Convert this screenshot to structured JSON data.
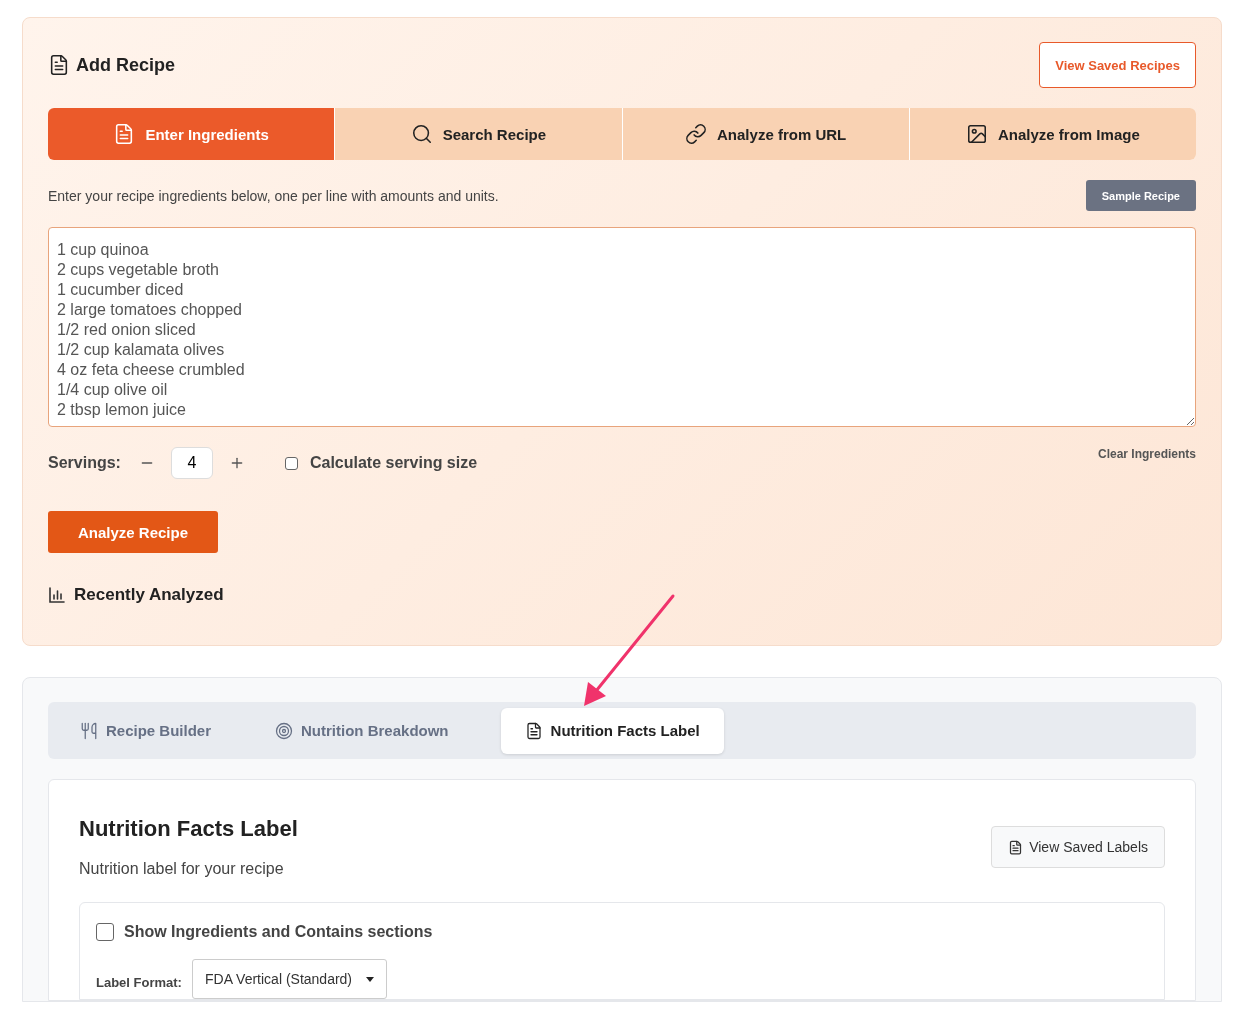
{
  "header": {
    "title": "Add Recipe",
    "saved_button": "View Saved Recipes"
  },
  "input_tabs": [
    {
      "label": "Enter Ingredients",
      "selected": true
    },
    {
      "label": "Search Recipe",
      "selected": false
    },
    {
      "label": "Analyze from URL",
      "selected": false
    },
    {
      "label": "Analyze from Image",
      "selected": false
    }
  ],
  "instructions": "Enter your recipe ingredients below, one per line with amounts and units.",
  "sample_button": "Sample Recipe",
  "ingredients": [
    "1 cup quinoa",
    "2 cups vegetable broth",
    "1 cucumber diced",
    "2 large tomatoes chopped",
    "1/2 red onion sliced",
    "1/2 cup kalamata olives",
    "4 oz feta cheese crumbled",
    "1/4 cup olive oil",
    "2 tbsp lemon juice"
  ],
  "servings": {
    "label": "Servings:",
    "value": "4"
  },
  "calculate_serving_size": {
    "label": "Calculate serving size",
    "checked": false
  },
  "clear_button": "Clear Ingredients",
  "analyze_button": "Analyze Recipe",
  "recent_heading": "Recently Analyzed",
  "view_tabs": [
    {
      "label": "Recipe Builder",
      "selected": false
    },
    {
      "label": "Nutrition Breakdown",
      "selected": false
    },
    {
      "label": "Nutrition Facts Label",
      "selected": true
    }
  ],
  "panel": {
    "title": "Nutrition Facts Label",
    "subtitle": "Nutrition label for your recipe",
    "saved_button": "View Saved Labels",
    "show_sections": {
      "label": "Show Ingredients and Contains sections",
      "checked": false
    },
    "format": {
      "label": "Label Format:",
      "value": "FDA Vertical (Standard)"
    }
  }
}
